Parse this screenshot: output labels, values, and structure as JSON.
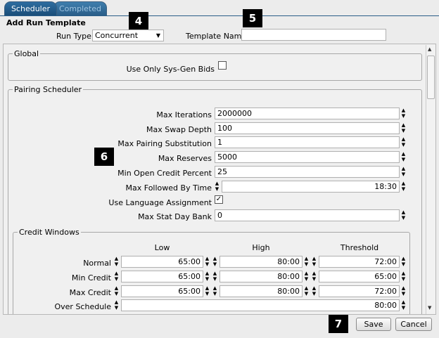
{
  "tabs": [
    {
      "label": "Scheduler"
    },
    {
      "label": "Completed"
    }
  ],
  "page_title": "Add Run Template",
  "badges": [
    "4",
    "5",
    "6",
    "7"
  ],
  "header": {
    "run_type_label": "Run Type",
    "run_type_value": "Concurrent",
    "template_name_label": "Template Name",
    "template_name_value": ""
  },
  "global": {
    "legend": "Global",
    "sysgen_label": "Use Only Sys-Gen Bids",
    "sysgen_checked": false
  },
  "pairing": {
    "legend": "Pairing Scheduler",
    "max_iterations_label": "Max Iterations",
    "max_iterations": "2000000",
    "max_swap_depth_label": "Max Swap Depth",
    "max_swap_depth": "100",
    "max_pairing_sub_label": "Max Pairing Substitution",
    "max_pairing_sub": "1",
    "max_reserves_label": "Max Reserves",
    "max_reserves": "5000",
    "min_open_credit_label": "Min Open Credit Percent",
    "min_open_credit": "25",
    "max_followed_label": "Max Followed By Time",
    "max_followed": "18:30",
    "use_language_label": "Use Language Assignment",
    "use_language_mark": "✓",
    "max_stat_label": "Max Stat Day Bank",
    "max_stat": "0"
  },
  "credit": {
    "legend": "Credit Windows",
    "col_low": "Low",
    "col_high": "High",
    "col_threshold": "Threshold",
    "rows": [
      {
        "label": "Normal",
        "low": "65:00",
        "high": "80:00",
        "threshold": "72:00"
      },
      {
        "label": "Min Credit",
        "low": "65:00",
        "high": "80:00",
        "threshold": "65:00"
      },
      {
        "label": "Max Credit",
        "low": "65:00",
        "high": "80:00",
        "threshold": "72:00"
      }
    ],
    "over_label": "Over Schedule",
    "over_value": "80:00"
  },
  "footer": {
    "save_label": "Save",
    "cancel_label": "Cancel"
  }
}
